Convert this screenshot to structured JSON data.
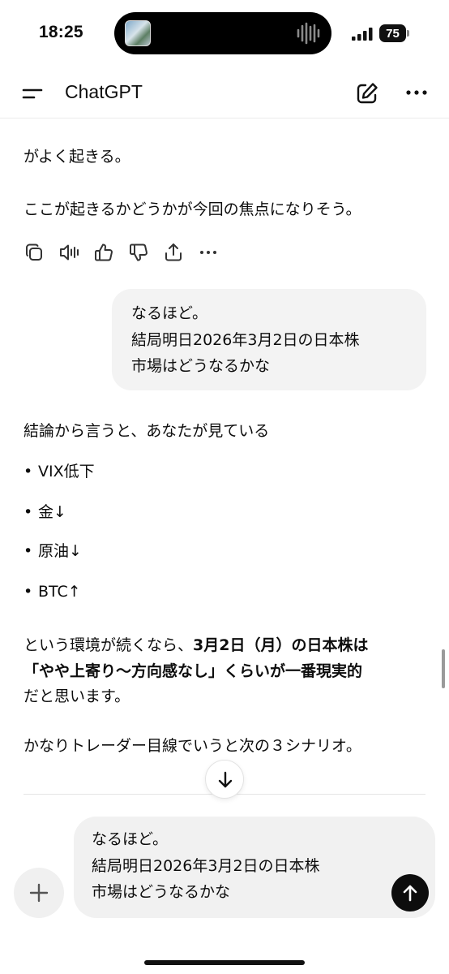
{
  "status_bar": {
    "time": "18:25",
    "battery": "75"
  },
  "header": {
    "title": "ChatGPT"
  },
  "messages": {
    "assistant_top": {
      "line1": "がよく起きる。",
      "line2": "ここが起きるかどうかが今回の焦点になりそう。"
    },
    "user": {
      "lines": [
        "なるほど。",
        "結局明日2026年3月2日の日本株",
        "市場はどうなるかな"
      ]
    },
    "assistant": {
      "intro": "結論から言うと、あなたが見ている",
      "bullet_marker": "•",
      "bullets": [
        "VIX低下",
        "金↓",
        "原油↓",
        "BTC↑"
      ],
      "p1_prefix": "という環境が続くなら、",
      "p1_bold": "3月2日（月）の日本株は",
      "p2_bold": "「やや上寄り〜方向感なし」くらいが一番現実的",
      "p3": "だと思います。",
      "p4": "かなりトレーダー目線でいうと次の３シナリオ。"
    }
  },
  "composer": {
    "lines": [
      "なるほど。",
      "結局明日2026年3月2日の日本株",
      "市場はどうなるかな"
    ]
  },
  "icons": {
    "menu": "menu-icon",
    "new_chat": "edit-icon",
    "more": "more-icon",
    "copy": "copy-icon",
    "read_aloud": "speaker-icon",
    "good": "thumbs-up-icon",
    "bad": "thumbs-down-icon",
    "share": "share-icon",
    "scroll_down": "arrow-down-icon",
    "add": "plus-icon",
    "send": "arrow-up-icon"
  },
  "colors": {
    "text": "#0d0d0d",
    "bubble": "#f3f3f3",
    "send": "#0d0d0d"
  }
}
